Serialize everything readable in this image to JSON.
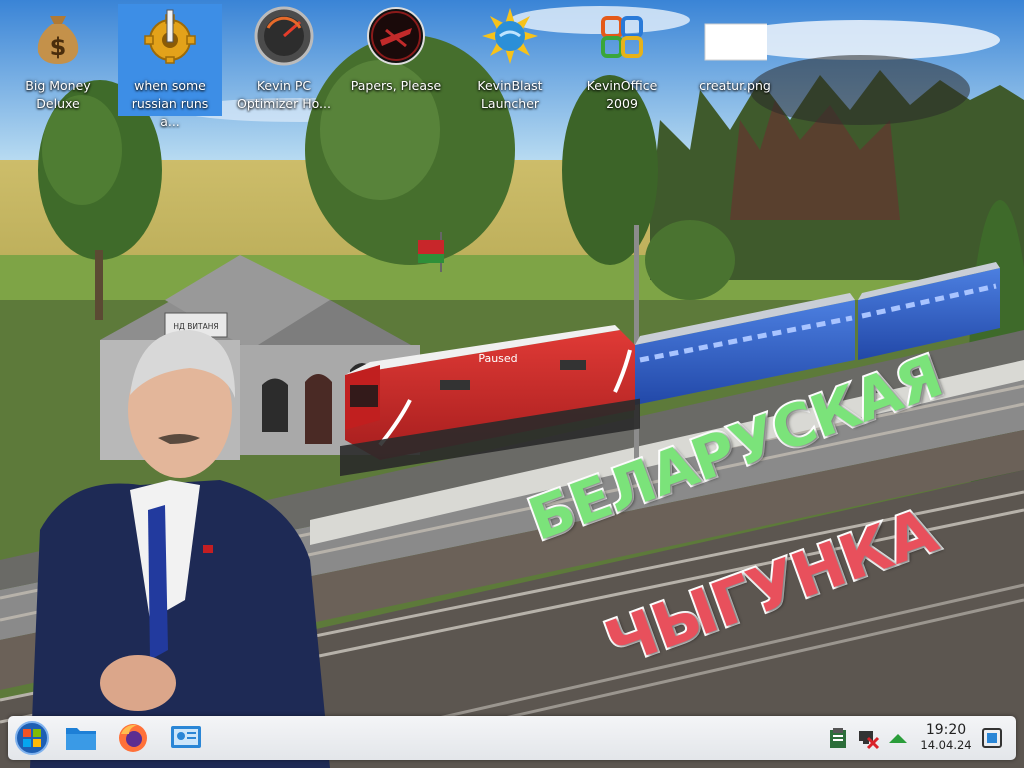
{
  "desktop_icons": [
    {
      "label": "Big Money Deluxe",
      "icon": "money-bag-icon",
      "selected": false
    },
    {
      "label": "when some russian runs a...",
      "icon": "gear-icon",
      "selected": true
    },
    {
      "label": "Kevin PC Optimizer Ho...",
      "icon": "speedometer-icon",
      "selected": false
    },
    {
      "label": "Papers, Please",
      "icon": "papers-please-icon",
      "selected": false
    },
    {
      "label": "KevinBlast Launcher",
      "icon": "sun-globe-icon",
      "selected": false
    },
    {
      "label": "KevinOffice 2009",
      "icon": "office-icon",
      "selected": false
    },
    {
      "label": "creatur.png",
      "icon": "image-file-icon",
      "selected": false
    }
  ],
  "wallpaper": {
    "locomotive_label": "Paused",
    "station_sign": "НД ВИТАНЯ",
    "title_line1": "БЕЛАРУСКАЯ",
    "title_line2": "ЧЫГУНКА",
    "colors": {
      "title_line1": "#7be37a",
      "title_line2": "#e8505c",
      "locomotive": "#cc2222",
      "carriage": "#2f5fc4"
    }
  },
  "taskbar": {
    "start_icon": "windows-start-icon",
    "pinned": [
      {
        "name": "file-manager-icon"
      },
      {
        "name": "firefox-icon"
      },
      {
        "name": "system-settings-icon"
      }
    ],
    "tray": [
      {
        "name": "clipboard-icon"
      },
      {
        "name": "network-disconnected-icon"
      },
      {
        "name": "up-arrow-icon"
      }
    ],
    "clock": {
      "time": "19:20",
      "date": "14.04.24"
    },
    "show_desktop_icon": "show-desktop-icon"
  }
}
